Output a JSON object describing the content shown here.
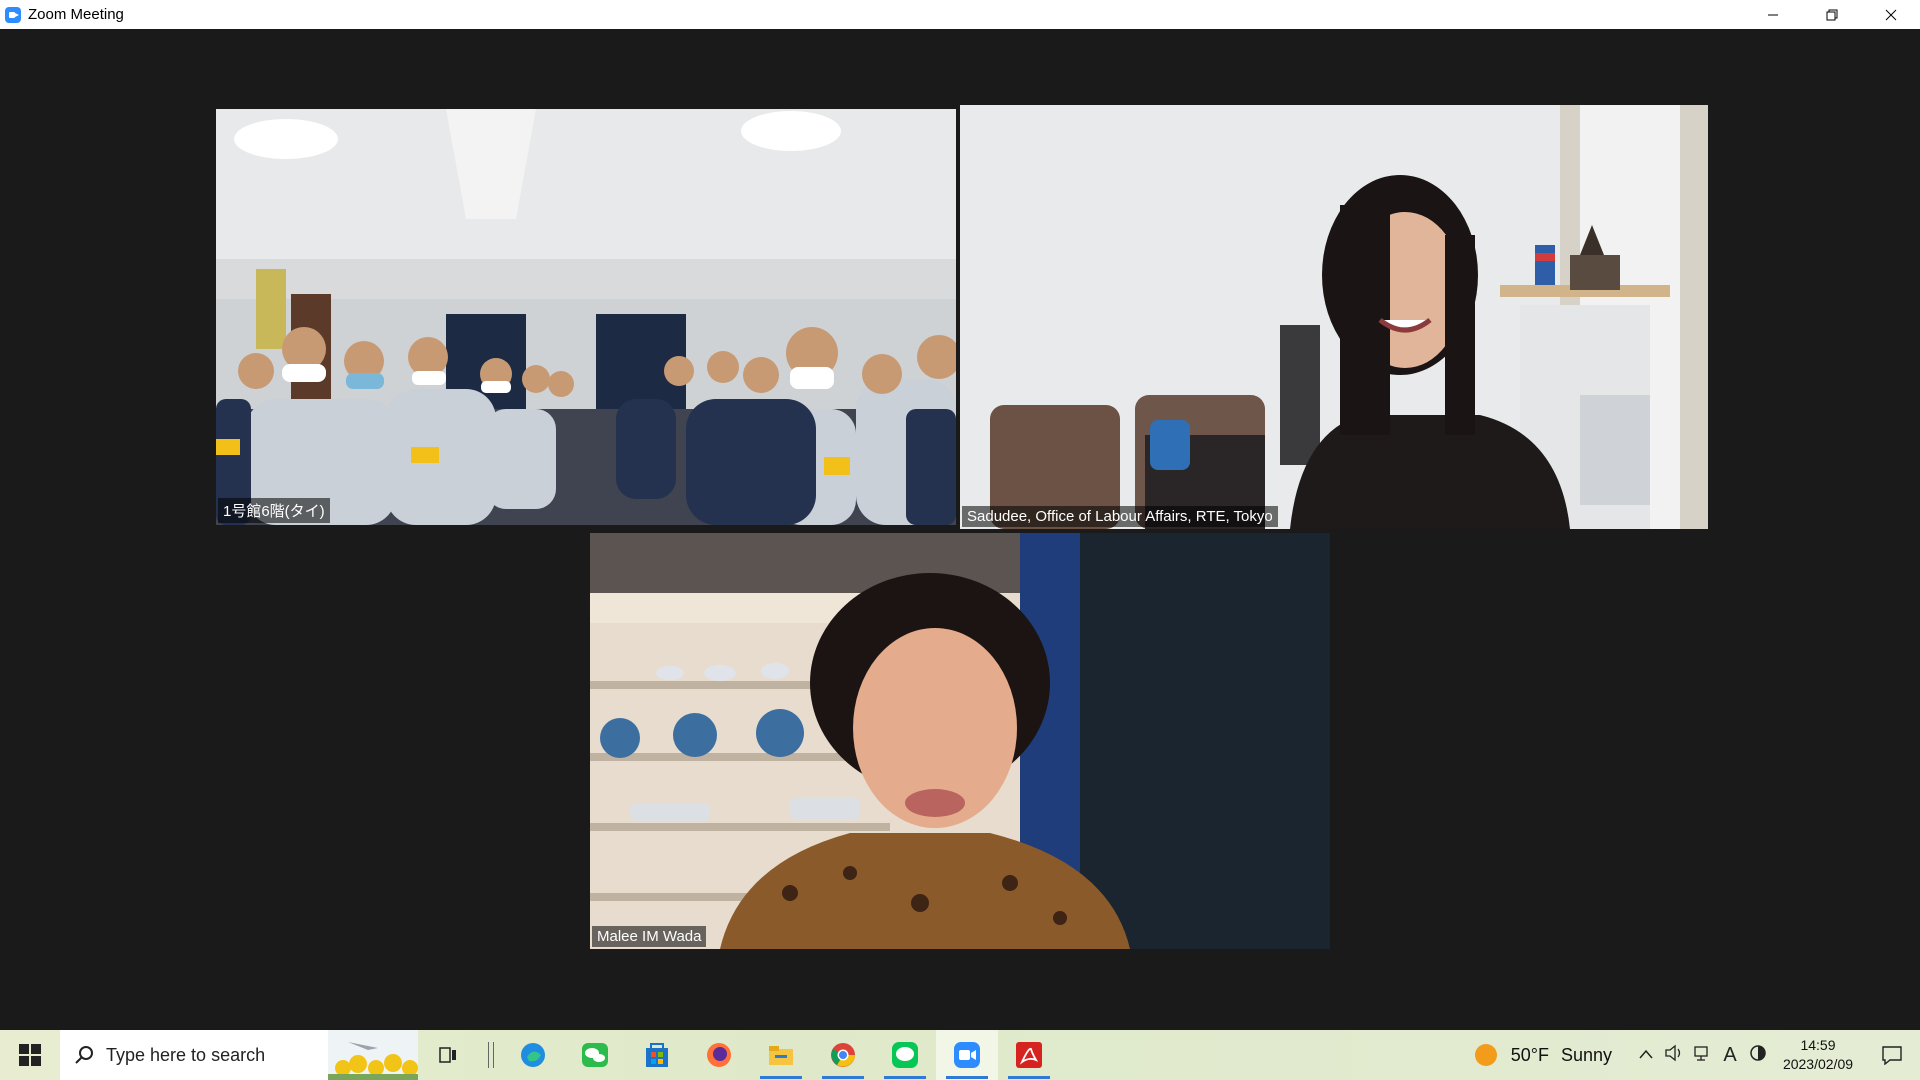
{
  "window": {
    "title": "Zoom Meeting",
    "controls": {
      "minimize": "—",
      "restore": "❐",
      "close": "✕"
    }
  },
  "participants": [
    {
      "name": "1号館6階(タイ)",
      "active_speaker": false
    },
    {
      "name": "Sadudee, Office of Labour Affairs, RTE, Tokyo",
      "active_speaker": true
    },
    {
      "name": "Malee IM Wada",
      "active_speaker": false
    }
  ],
  "colors": {
    "active_speaker_border": "#d7ee6a",
    "background": "#1a1a1a",
    "zoom_blue": "#2d8cff"
  },
  "taskbar": {
    "search_placeholder": "Type here to search",
    "pinned": [
      {
        "icon": "task-view-icon",
        "running": false
      },
      {
        "icon": "edge-icon",
        "running": false
      },
      {
        "icon": "wechat-icon",
        "running": false
      },
      {
        "icon": "store-icon",
        "running": false
      },
      {
        "icon": "firefox-icon",
        "running": false
      },
      {
        "icon": "file-explorer-icon",
        "running": true
      },
      {
        "icon": "chrome-icon",
        "running": true
      },
      {
        "icon": "line-icon",
        "running": true
      },
      {
        "icon": "zoom-icon",
        "running": true,
        "active": true
      },
      {
        "icon": "acrobat-icon",
        "running": true
      }
    ],
    "weather": {
      "temp": "50°F",
      "condition": "Sunny"
    },
    "ime": "A",
    "clock": {
      "time": "14:59",
      "date": "2023/02/09"
    }
  }
}
